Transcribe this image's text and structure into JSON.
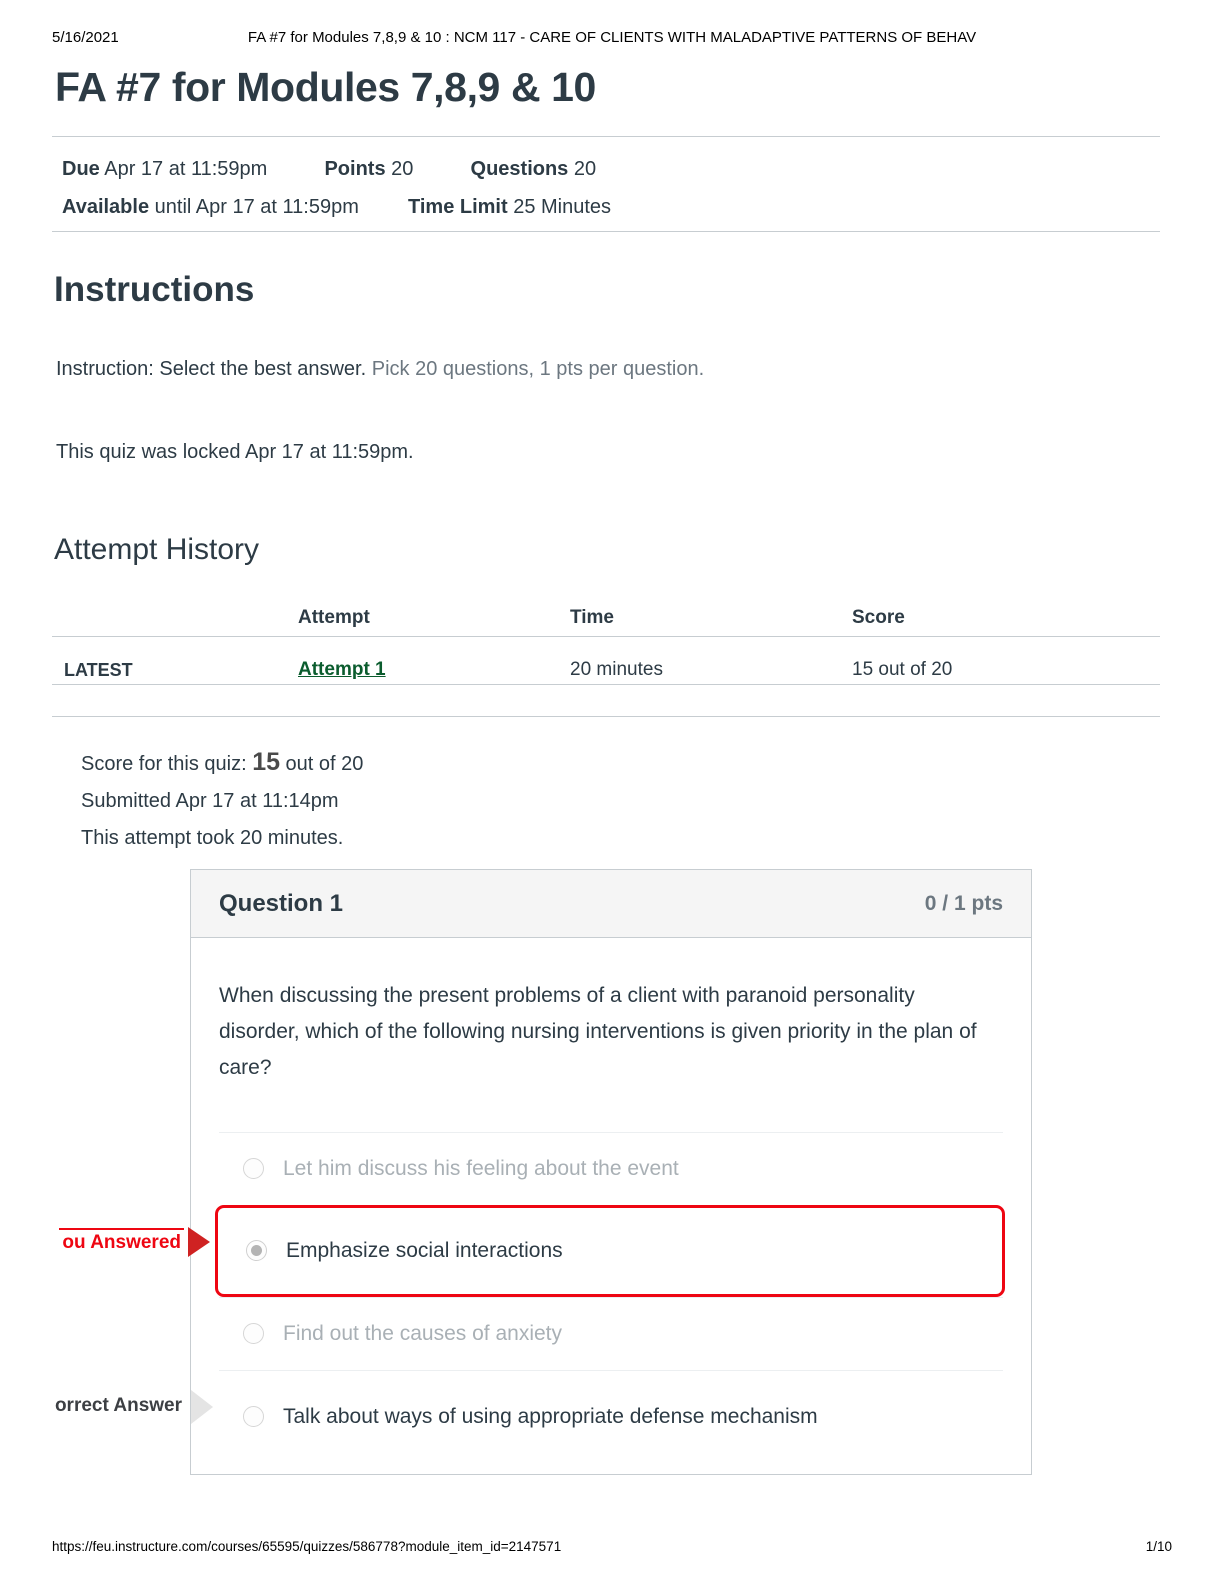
{
  "print_header": {
    "date": "5/16/2021",
    "title": "FA #7 for Modules 7,8,9 & 10 : NCM 117 - CARE OF CLIENTS WITH MALADAPTIVE PATTERNS OF BEHAV"
  },
  "print_footer": {
    "url": "https://feu.instructure.com/courses/65595/quizzes/586778?module_item_id=2147571",
    "page": "1/10"
  },
  "quiz": {
    "title": "FA #7 for Modules 7,8,9 & 10",
    "meta": {
      "due_label": "Due",
      "due_value": "Apr 17 at 11:59pm",
      "points_label": "Points",
      "points_value": "20",
      "questions_label": "Questions",
      "questions_value": "20",
      "available_label": "Available",
      "available_value": "until Apr 17 at 11:59pm",
      "time_limit_label": "Time Limit",
      "time_limit_value": "25 Minutes"
    }
  },
  "instructions": {
    "heading": "Instructions",
    "line1_strong": "Instruction: Select the best answer.",
    "line1_muted": " Pick 20 questions, 1 pts per question.",
    "line2": "This quiz was locked Apr 17 at 11:59pm."
  },
  "attempt_history": {
    "heading": "Attempt History",
    "columns": [
      "",
      "Attempt",
      "Time",
      "Score"
    ],
    "rows": [
      {
        "latest": "LATEST",
        "attempt": "Attempt 1 ",
        "time": "20 minutes",
        "score": "15 out of 20"
      }
    ]
  },
  "score_summary": {
    "score_prefix": "Score for this quiz: ",
    "score_value": "15",
    "score_suffix": " out of 20",
    "submitted": "Submitted Apr 17 at 11:14pm",
    "duration": "This attempt took 20 minutes."
  },
  "question": {
    "name": "Question 1",
    "points": "0 / 1 pts",
    "text": "When discussing the present problems of a client with paranoid personality disorder, which of the following nursing interventions is given priority in the plan of care?",
    "answers": [
      {
        "text": "Let him discuss his feeling about the event",
        "selected": false,
        "state": "dim",
        "flag": ""
      },
      {
        "text": "Emphasize social interactions",
        "selected": true,
        "state": "dark",
        "flag": "ou Answered"
      },
      {
        "text": "Find out the causes of anxiety",
        "selected": false,
        "state": "dim",
        "flag": ""
      },
      {
        "text": "Talk about ways of using appropriate defense mechanism",
        "selected": false,
        "state": "dark",
        "flag": "orrect Answer"
      }
    ]
  },
  "colors": {
    "incorrect_red": "#ee0612",
    "link_green": "#0b5c2e",
    "muted_gray": "#6c7780",
    "border_gray": "#c7cdd1"
  }
}
